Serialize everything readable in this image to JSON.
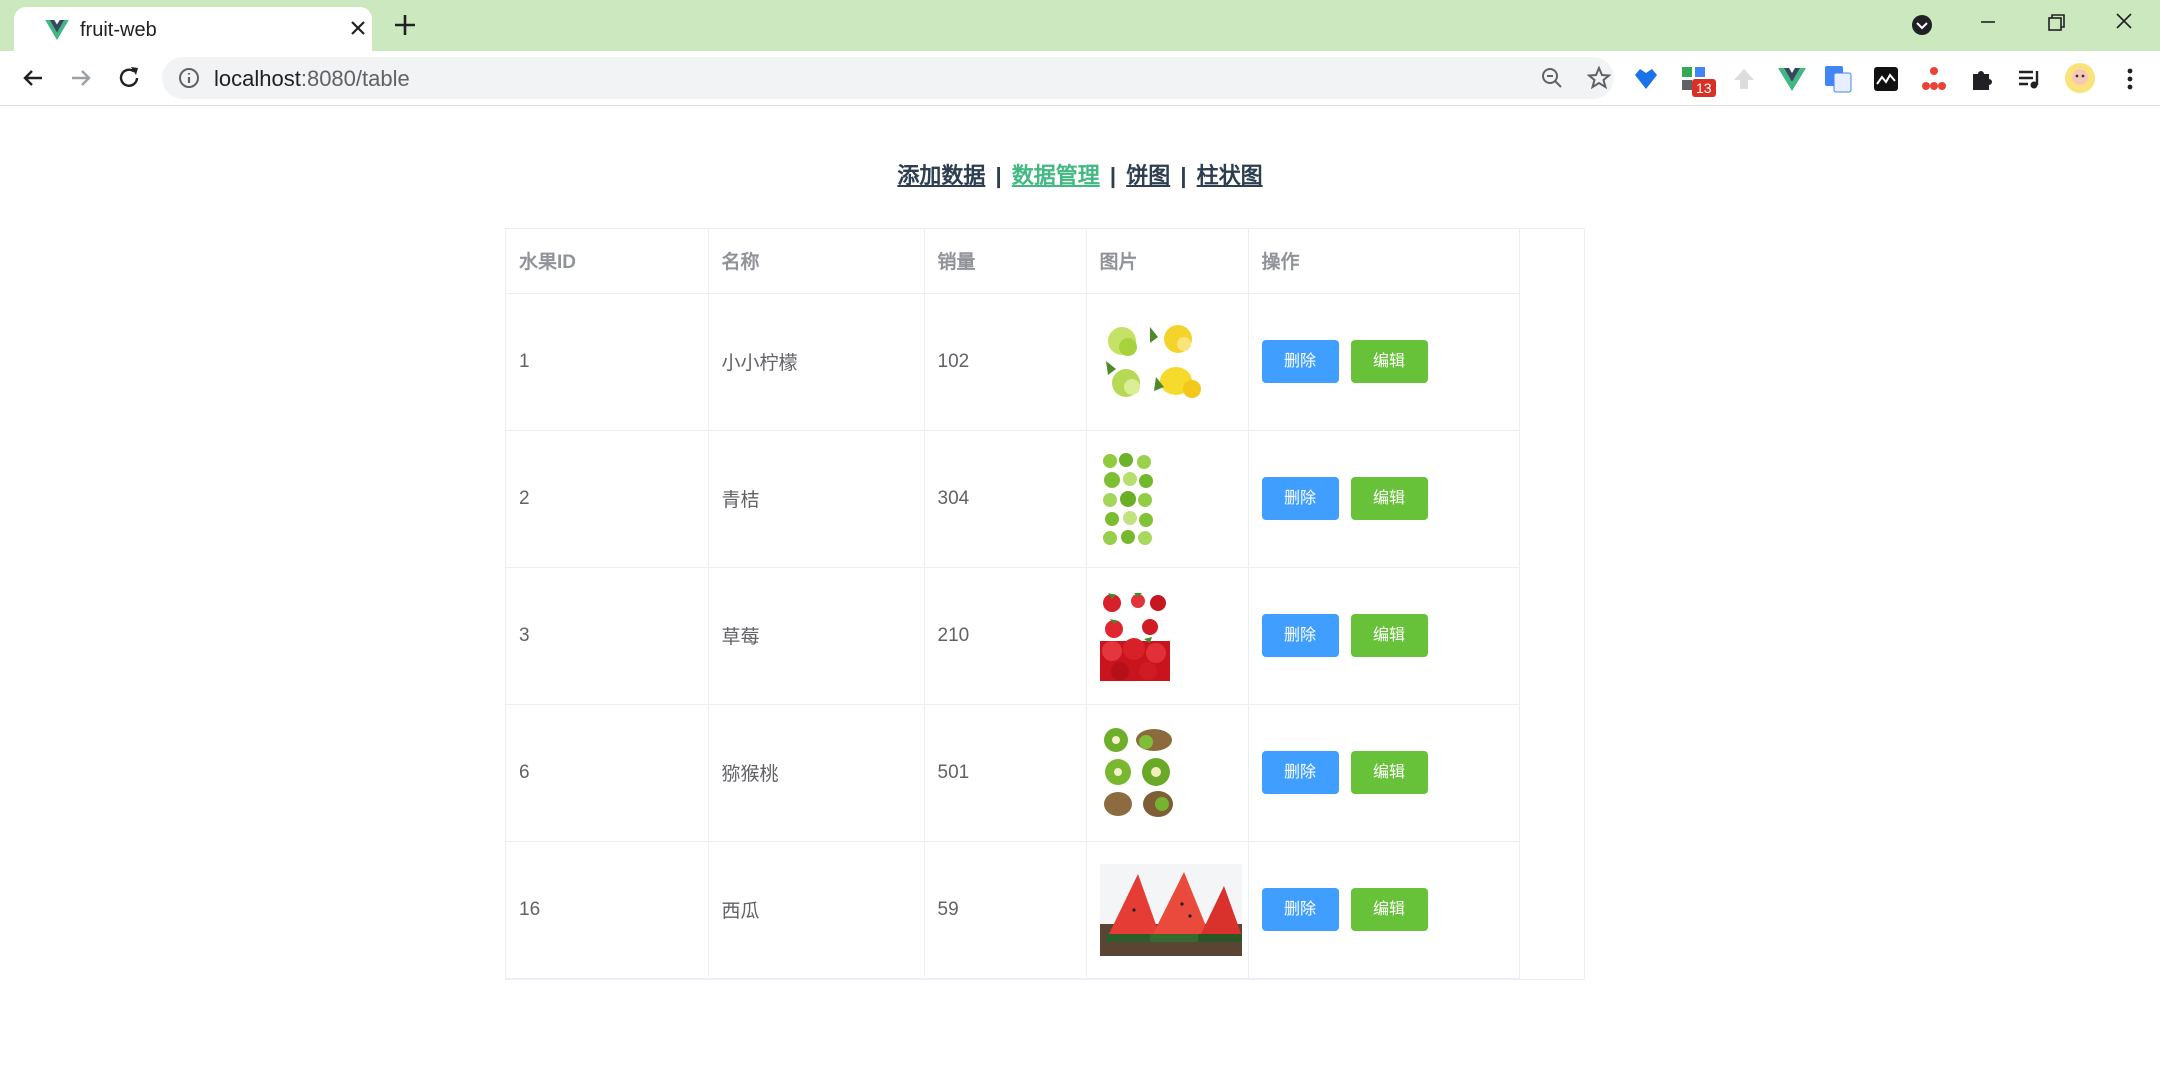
{
  "browser": {
    "tab_title": "fruit-web",
    "url_host": "localhost",
    "url_port_path": ":8080/table",
    "extension_badge": "13"
  },
  "nav": {
    "items": [
      {
        "label": "添加数据",
        "active": false
      },
      {
        "label": "数据管理",
        "active": true
      },
      {
        "label": "饼图",
        "active": false
      },
      {
        "label": "柱状图",
        "active": false
      }
    ],
    "separator": "|"
  },
  "table": {
    "headers": [
      "水果ID",
      "名称",
      "销量",
      "图片",
      "操作"
    ],
    "rows": [
      {
        "id": "1",
        "name": "小小柠檬",
        "sales": "102",
        "image": "lemon"
      },
      {
        "id": "2",
        "name": "青桔",
        "sales": "304",
        "image": "lime"
      },
      {
        "id": "3",
        "name": "草莓",
        "sales": "210",
        "image": "strawberry"
      },
      {
        "id": "6",
        "name": "猕猴桃",
        "sales": "501",
        "image": "kiwi"
      },
      {
        "id": "16",
        "name": "西瓜",
        "sales": "59",
        "image": "watermelon"
      }
    ],
    "delete_label": "删除",
    "edit_label": "编辑"
  },
  "colors": {
    "tabbar": "#cbe8be",
    "nav_active": "#42b983",
    "delete_button": "#409eff",
    "edit_button": "#67c23a"
  }
}
